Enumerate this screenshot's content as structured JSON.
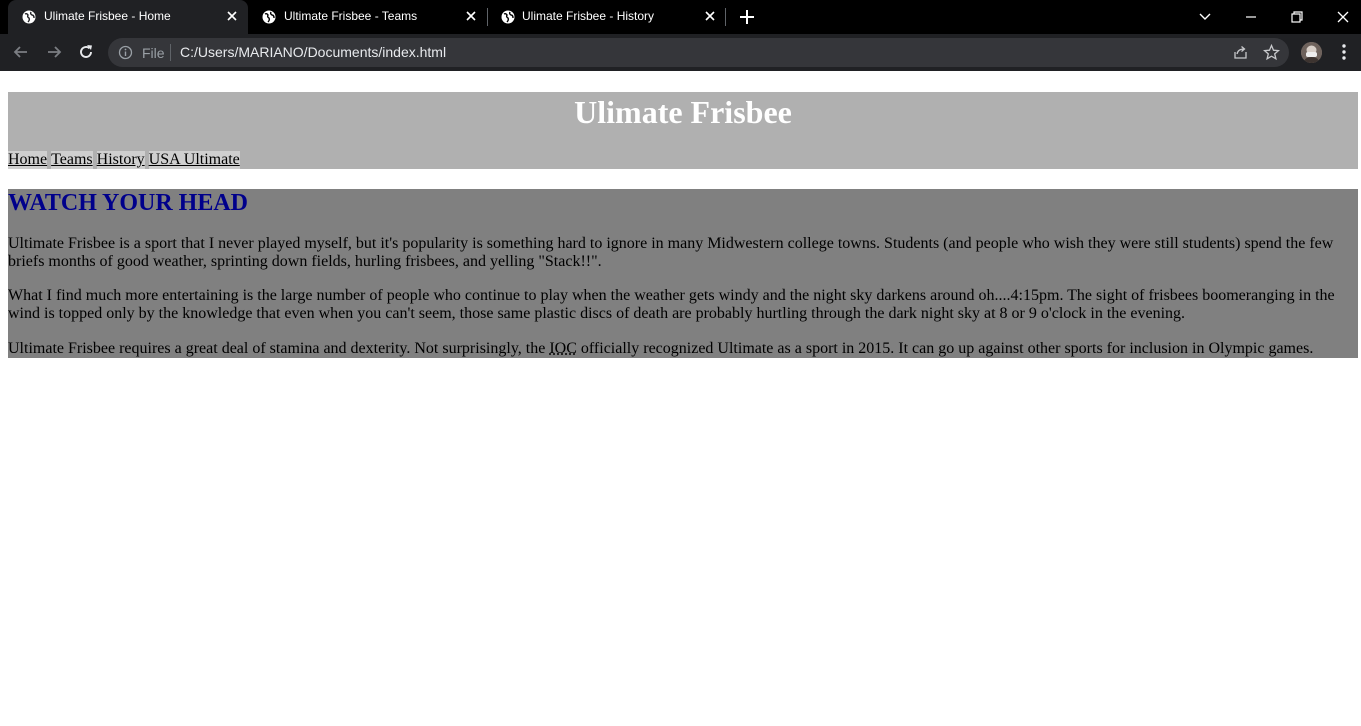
{
  "browser": {
    "tabs": [
      {
        "title": "Ulimate Frisbee - Home",
        "active": true
      },
      {
        "title": "Ultimate Frisbee - Teams",
        "active": false
      },
      {
        "title": "Ulimate Frisbee - History",
        "active": false
      }
    ],
    "address": {
      "scheme_label": "File",
      "url": "C:/Users/MARIANO/Documents/index.html"
    },
    "icons": {
      "back": "arrow-left-icon",
      "forward": "arrow-right-icon",
      "reload": "reload-icon",
      "info": "info-icon",
      "share": "share-icon",
      "bookmark": "star-icon",
      "menu": "kebab-menu-icon",
      "new_tab": "plus-icon",
      "tab_search": "chevron-down-icon",
      "minimize": "minimize-icon",
      "restore": "restore-icon",
      "close_window": "close-icon"
    },
    "colors": {
      "tabstrip": "#000000",
      "toolbar": "#202124",
      "omnibox": "#35363a"
    }
  },
  "page": {
    "header": {
      "title": "Ulimate Frisbee",
      "nav": [
        "Home",
        "Teams",
        "History",
        "USA Ultimate"
      ]
    },
    "article": {
      "heading": "WATCH YOUR HEAD",
      "p1": "Ultimate Frisbee is a sport that I never played myself, but it's popularity is something hard to ignore in many Midwestern college towns. Students (and people who wish they were still students) spend the few briefs months of good weather, sprinting down fields, hurling frisbees, and yelling \"Stack!!\".",
      "p2": "What I find much more entertaining is the large number of people who continue to play when the weather gets windy and the night sky darkens around oh....4:15pm. The sight of frisbees boomeranging in the wind is topped only by the knowledge that even when you can't seem, those same plastic discs of death are probably hurtling through the dark night sky at 8 or 9 o'clock in the evening.",
      "p3_before": "Ultimate Frisbee requires a great deal of stamina and dexterity. Not surprisingly, the ",
      "p3_abbr": "IOC",
      "p3_after": " officially recognized Ultimate as a sport in 2015. It can go up against other sports for inclusion in Olympic games."
    },
    "colors": {
      "header_bg": "#b0b0b0",
      "title": "#ffffff",
      "nav_bg": "#cfcfcf",
      "article_bg": "#808080",
      "heading": "#00008b"
    }
  }
}
